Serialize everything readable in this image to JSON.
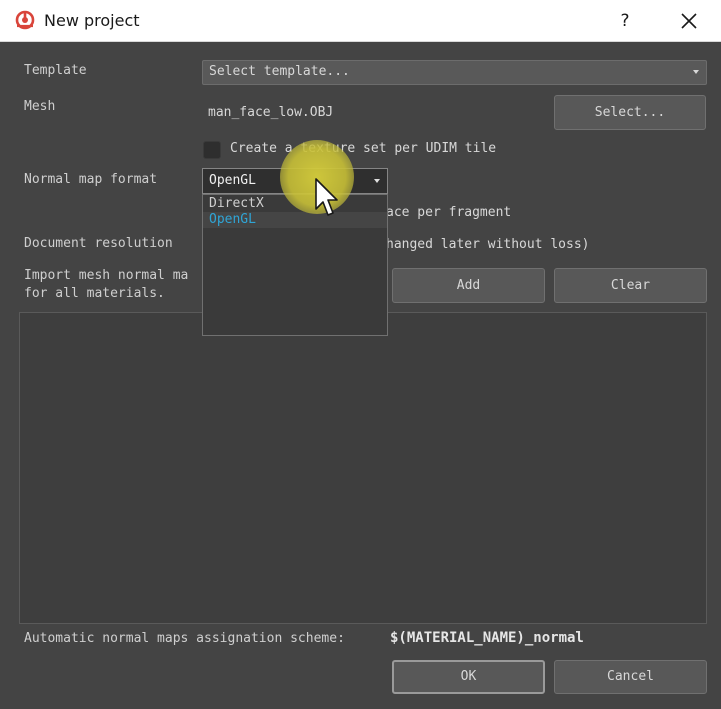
{
  "window": {
    "title": "New project",
    "help_label": "?",
    "accent_color": "#d9453b"
  },
  "form": {
    "template": {
      "label": "Template",
      "value": "Select template..."
    },
    "mesh": {
      "label": "Mesh",
      "value": "man_face_low.OBJ",
      "select_button": "Select..."
    },
    "udim_checkbox": {
      "label": "Create a texture set per UDIM tile",
      "checked": false
    },
    "normal_map_format": {
      "label": "Normal map format",
      "value": "OpenGL",
      "options": [
        "DirectX",
        "OpenGL"
      ],
      "selected_index": 1,
      "highlight_color": "#2fa5d6"
    },
    "tangent_fragment_fragment": "ace per fragment",
    "document_resolution": {
      "label": "Document resolution",
      "note_fragment": "hanged later without loss)"
    },
    "import_normal_maps": {
      "label_line1": "Import mesh normal ma",
      "label_line2": "for all materials."
    },
    "add_button": "Add",
    "clear_button": "Clear"
  },
  "footer": {
    "scheme_label": "Automatic normal maps assignation scheme:",
    "scheme_value": "$(MATERIAL_NAME)_normal",
    "ok_button": "OK",
    "cancel_button": "Cancel"
  }
}
